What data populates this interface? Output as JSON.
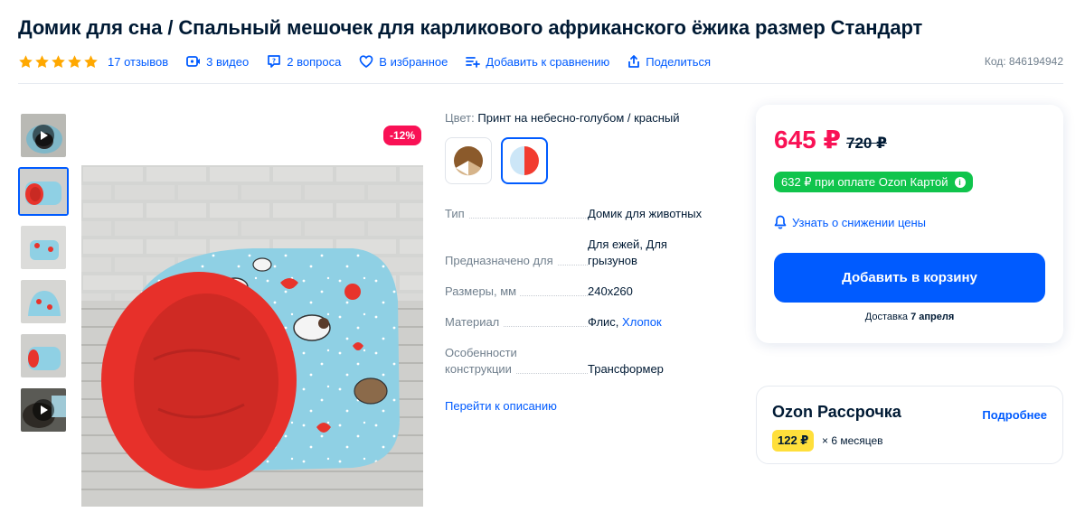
{
  "product": {
    "title": "Домик для сна / Спальный мешочек для карликового африканского ёжика размер Стандарт",
    "code_label": "Код:",
    "code_value": "846194942"
  },
  "meta": {
    "rating_stars": 5,
    "reviews": "17 отзывов",
    "videos": "3 видео",
    "questions": "2 вопроса",
    "favorites": "В избранное",
    "compare": "Добавить к сравнению",
    "share": "Поделиться"
  },
  "gallery": {
    "discount_badge": "-12%",
    "thumbnails": [
      "video",
      "image",
      "image",
      "image",
      "image",
      "video"
    ],
    "active_index": 1
  },
  "color": {
    "label": "Цвет:",
    "value": "Принт на небесно-голубом / красный",
    "swatches": [
      {
        "name": "brown",
        "colors": [
          "#8b5a2b",
          "#ffffff"
        ]
      },
      {
        "name": "blue-red",
        "colors": [
          "#cce6f7",
          "#f23b2f"
        ]
      }
    ],
    "active_index": 1
  },
  "specs": [
    {
      "key": "Тип",
      "value": "Домик для животных"
    },
    {
      "key": "Предназначено для",
      "value": "Для ежей, Для грызунов"
    },
    {
      "key": "Размеры, мм",
      "value": "240x260"
    },
    {
      "key": "Материал",
      "value": "Флис,",
      "link": "Хлопок"
    },
    {
      "key": "Особенности конструкции",
      "value": "Трансформер"
    }
  ],
  "to_description": "Перейти к описанию",
  "price": {
    "current": "645 ₽",
    "old": "720 ₽",
    "card_offer": "632 ₽ при оплате Ozon Картой",
    "notify": "Узнать о снижении цены",
    "add_to_cart": "Добавить в корзину",
    "delivery_prefix": "Доставка",
    "delivery_date": "7 апреля"
  },
  "installment": {
    "title": "Ozon Рассрочка",
    "more": "Подробнее",
    "amount": "122 ₽",
    "months": "× 6 месяцев"
  },
  "colors": {
    "accent": "#005bff",
    "price": "#f91155",
    "green": "#10c44c",
    "yellow": "#ffdf3b",
    "star": "#ffa800"
  }
}
